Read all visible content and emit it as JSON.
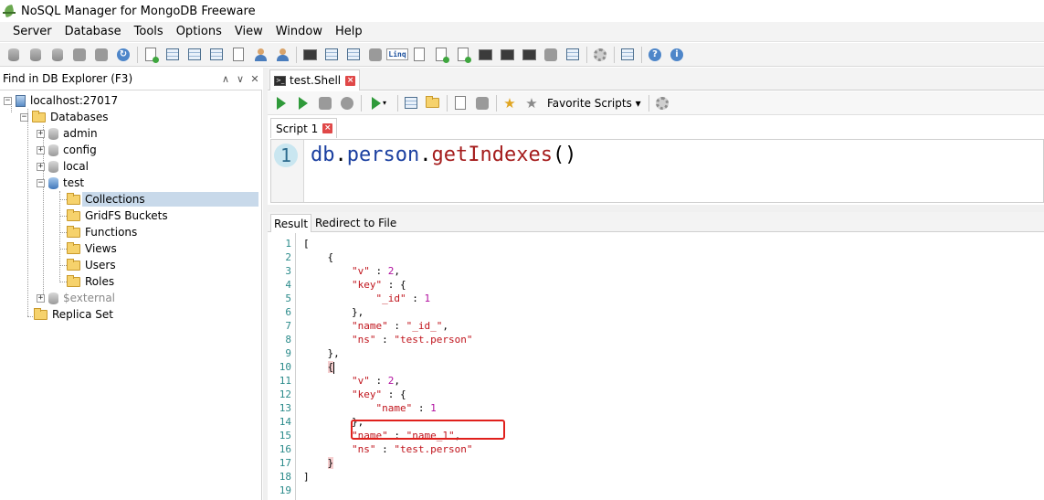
{
  "window": {
    "title": "NoSQL Manager for MongoDB Freeware"
  },
  "menu": {
    "items": [
      "Server",
      "Database",
      "Tools",
      "Options",
      "View",
      "Window",
      "Help"
    ]
  },
  "explorer": {
    "find_placeholder": "Find in DB Explorer (F3)",
    "tree": {
      "server": "localhost:27017",
      "databases_label": "Databases",
      "dbs": [
        "admin",
        "config",
        "local",
        "test"
      ],
      "test_children": [
        "Collections",
        "GridFS Buckets",
        "Functions",
        "Views",
        "Users",
        "Roles"
      ],
      "external": "$external",
      "replica_set": "Replica Set"
    }
  },
  "doc_tab": {
    "label": "test.Shell",
    "close": "×"
  },
  "shell_toolbar": {
    "favorite_scripts": "Favorite Scripts"
  },
  "script_tab": {
    "label": "Script 1",
    "close": "×"
  },
  "editor": {
    "line_number": "1",
    "code": {
      "obj": "db",
      "dot1": ".",
      "prop": "person",
      "dot2": ".",
      "method": "getIndexes",
      "parens": "()"
    }
  },
  "result_tabs": {
    "result": "Result",
    "redirect": "Redirect to File"
  },
  "result": {
    "line_numbers": [
      "1",
      "2",
      "3",
      "4",
      "5",
      "6",
      "7",
      "8",
      "9",
      "10",
      "11",
      "12",
      "13",
      "14",
      "15",
      "16",
      "17",
      "18",
      "19"
    ],
    "lines": {
      "l1": "[",
      "l2": "{",
      "l3_key": "\"v\"",
      "l3_sep": " : ",
      "l3_val": "2",
      "l3_end": ",",
      "l4_key": "\"key\"",
      "l4_rest": " : {",
      "l5_key": "\"_id\"",
      "l5_sep": " : ",
      "l5_val": "1",
      "l6": "},",
      "l7_key": "\"name\"",
      "l7_sep": " : ",
      "l7_val": "\"_id_\"",
      "l7_end": ",",
      "l8_key": "\"ns\"",
      "l8_sep": " : ",
      "l8_val": "\"test.person\"",
      "l9": "},",
      "l10": "{",
      "l11_key": "\"v\"",
      "l11_sep": " : ",
      "l11_val": "2",
      "l11_end": ",",
      "l12_key": "\"key\"",
      "l12_rest": " : {",
      "l13_key": "\"name\"",
      "l13_sep": " : ",
      "l13_val": "1",
      "l14": "},",
      "l15_key": "\"name\"",
      "l15_sep": " : ",
      "l15_val": "\"name_1\"",
      "l15_end": ",",
      "l16_key": "\"ns\"",
      "l16_sep": " : ",
      "l16_val": "\"test.person\"",
      "l17": "}",
      "l18": "]",
      "l19": ""
    }
  },
  "colors": {
    "string": "#c0141c",
    "number": "#b1109f",
    "annotation_box": "#e0201c"
  }
}
